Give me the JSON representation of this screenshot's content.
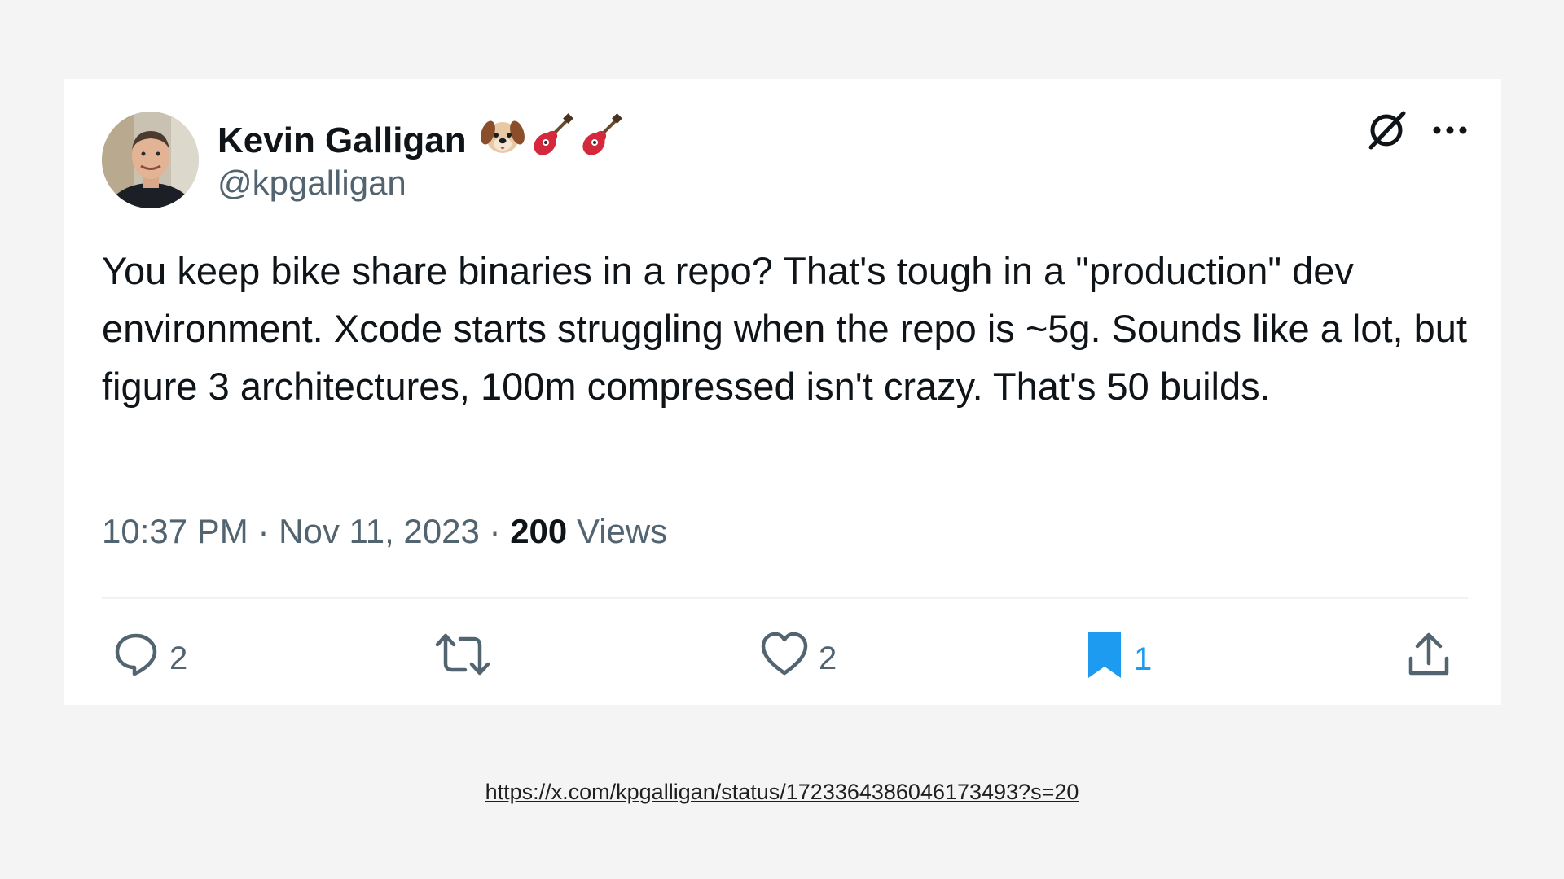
{
  "tweet": {
    "author": {
      "display_name": "Kevin Galligan",
      "name_emojis": [
        "dog-face-icon",
        "guitar-icon",
        "guitar-icon"
      ],
      "handle": "@kpgalligan"
    },
    "top_icons": [
      "grok-icon",
      "more-options-icon"
    ],
    "text": "You keep bike share binaries in a repo? That's tough in a \"production\" dev environment. Xcode starts struggling when the repo is ~5g. Sounds like a lot, but figure 3 architectures, 100m compressed isn't crazy. That's 50 builds.",
    "timestamp": "10:37 PM",
    "separator": "·",
    "date": "Nov 11, 2023",
    "views_count": "200",
    "views_label": "Views",
    "actions": {
      "reply": {
        "icon": "reply-icon",
        "count": "2"
      },
      "retweet": {
        "icon": "retweet-icon",
        "count": ""
      },
      "like": {
        "icon": "heart-icon",
        "count": "2"
      },
      "bookmark": {
        "icon": "bookmark-icon",
        "count": "1",
        "active": true
      },
      "share": {
        "icon": "share-icon",
        "count": ""
      }
    }
  },
  "source_url": "https://x.com/kpgalligan/status/1723364386046173493?s=20",
  "colors": {
    "background": "#f4f4f4",
    "card": "#ffffff",
    "text_primary": "#0f1419",
    "text_secondary": "#536471",
    "accent": "#1d9bf0"
  }
}
